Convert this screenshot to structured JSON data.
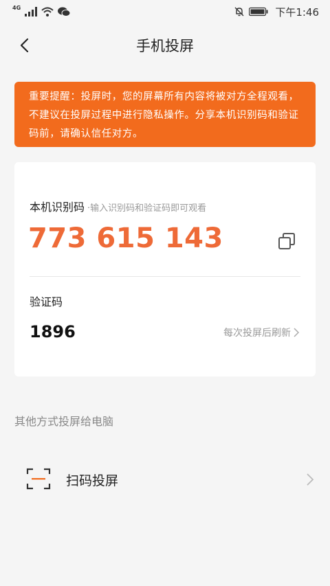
{
  "status_bar": {
    "network": "4G",
    "time": "下午1:46"
  },
  "header": {
    "title": "手机投屏",
    "back_icon": "chevron-left-icon"
  },
  "warning": {
    "text": "重要提醒：投屏时，您的屏幕所有内容将被对方全程观看，不建议在投屏过程中进行隐私操作。分享本机识别码和验证码前，请确认信任对方。",
    "background": "#f26b1d"
  },
  "card": {
    "id_label": "本机识别码",
    "id_hint": "·输入识别码和验证码即可观看",
    "id_number": "773 615 143",
    "id_color": "#ee6a37",
    "copy_icon": "copy-icon",
    "code_label": "验证码",
    "code_value": "1896",
    "refresh_text": "每次投屏后刷新"
  },
  "other": {
    "title": "其他方式投屏给电脑",
    "scan_label": "扫码投屏",
    "scan_icon": "scan-icon"
  }
}
